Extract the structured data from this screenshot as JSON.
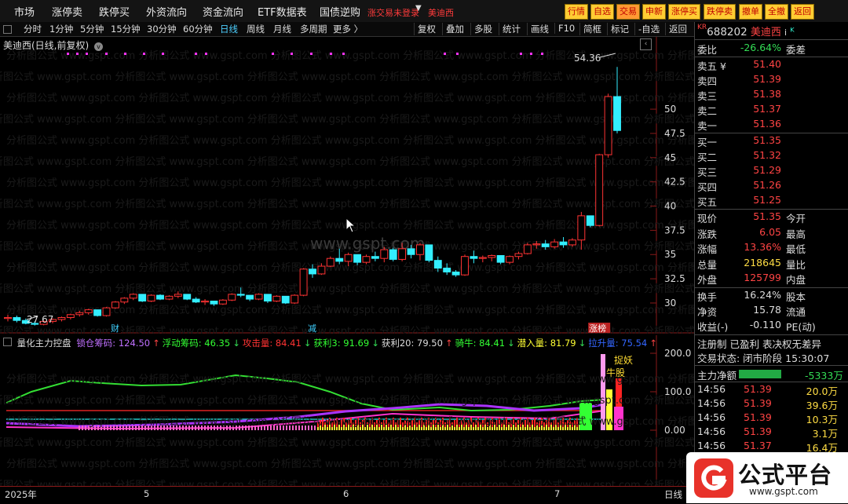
{
  "topmenu": {
    "items": [
      "市场",
      "涨停卖",
      "跌停买",
      "外资流向",
      "资金流向",
      "ETF数据表",
      "国债逆购"
    ],
    "notice": "涨交易未登录",
    "stock_name": "美迪西",
    "quick_buttons": [
      "行情",
      "自选",
      "交易",
      "申新",
      "涨停买",
      "跌停卖",
      "撤单",
      "全撤",
      "返回"
    ]
  },
  "periodbar": {
    "periods": [
      "分时",
      "1分钟",
      "5分钟",
      "15分钟",
      "30分钟",
      "60分钟",
      "日线",
      "周线",
      "月线",
      "多周期",
      "更多 〉"
    ],
    "selected": "日线",
    "tools": [
      "复权",
      "叠加",
      "多股",
      "统计",
      "画线",
      "F10",
      "简框",
      "标记",
      "-自选",
      "返回"
    ]
  },
  "chart_title": "美迪西(日线,前复权)",
  "chart_data": {
    "type": "candlestick",
    "title": "美迪西(日线,前复权)",
    "y_ticks": [
      50.0,
      47.5,
      45.0,
      42.5,
      40.0,
      37.5,
      35.0,
      32.5,
      30.0
    ],
    "ylim": [
      27.0,
      56.0
    ],
    "max_label": "54.36",
    "min_label": "27.67",
    "candles": [
      [
        28.4,
        28.8,
        28.1,
        28.5
      ],
      [
        28.5,
        28.7,
        28.0,
        28.2
      ],
      [
        28.2,
        28.4,
        27.8,
        27.9
      ],
      [
        27.9,
        28.1,
        27.67,
        27.8
      ],
      [
        27.8,
        28.2,
        27.7,
        28.1
      ],
      [
        28.1,
        28.4,
        27.9,
        28.3
      ],
      [
        28.3,
        28.6,
        28.1,
        28.5
      ],
      [
        28.5,
        28.9,
        28.3,
        28.8
      ],
      [
        28.8,
        29.2,
        28.6,
        29.0
      ],
      [
        29.0,
        29.4,
        28.8,
        29.3
      ],
      [
        29.3,
        29.0,
        28.6,
        28.7
      ],
      [
        28.7,
        29.6,
        28.6,
        29.5
      ],
      [
        29.5,
        30.2,
        29.4,
        30.1
      ],
      [
        30.1,
        30.6,
        29.9,
        30.5
      ],
      [
        30.5,
        31.0,
        30.3,
        30.9
      ],
      [
        30.9,
        30.8,
        30.1,
        30.2
      ],
      [
        30.2,
        30.9,
        30.1,
        30.8
      ],
      [
        30.8,
        30.9,
        30.3,
        30.4
      ],
      [
        30.4,
        30.8,
        30.3,
        30.7
      ],
      [
        30.7,
        31.2,
        30.5,
        30.9
      ],
      [
        30.9,
        30.8,
        30.3,
        30.4
      ],
      [
        30.4,
        30.6,
        30.0,
        30.1
      ],
      [
        30.1,
        30.4,
        29.8,
        30.2
      ],
      [
        30.2,
        30.0,
        29.7,
        29.9
      ],
      [
        29.9,
        30.4,
        29.8,
        30.3
      ],
      [
        30.3,
        31.0,
        30.2,
        30.9
      ],
      [
        30.9,
        31.6,
        30.6,
        30.8
      ],
      [
        30.8,
        30.7,
        30.2,
        30.4
      ],
      [
        30.4,
        31.0,
        30.3,
        30.9
      ],
      [
        30.9,
        30.6,
        30.0,
        30.2
      ],
      [
        30.2,
        30.8,
        30.1,
        30.7
      ],
      [
        30.7,
        30.4,
        29.9,
        30.0
      ],
      [
        30.0,
        30.9,
        29.9,
        30.8
      ],
      [
        30.8,
        33.6,
        30.7,
        33.5
      ],
      [
        33.5,
        34.0,
        32.6,
        33.0
      ],
      [
        33.0,
        34.1,
        32.9,
        33.8
      ],
      [
        33.8,
        34.8,
        33.7,
        34.6
      ],
      [
        34.6,
        35.6,
        34.0,
        34.3
      ],
      [
        34.3,
        35.2,
        33.8,
        35.0
      ],
      [
        35.0,
        34.9,
        33.9,
        34.2
      ],
      [
        34.2,
        35.0,
        34.0,
        34.8
      ],
      [
        34.8,
        35.3,
        34.3,
        34.6
      ],
      [
        34.6,
        35.8,
        34.2,
        35.5
      ],
      [
        35.5,
        35.7,
        34.3,
        34.5
      ],
      [
        34.5,
        36.2,
        34.3,
        35.6
      ],
      [
        35.6,
        36.0,
        34.6,
        35.0
      ],
      [
        35.0,
        36.2,
        34.4,
        36.0
      ],
      [
        36.0,
        35.8,
        34.2,
        34.4
      ],
      [
        34.4,
        34.8,
        33.2,
        33.6
      ],
      [
        33.6,
        34.1,
        32.9,
        33.2
      ],
      [
        33.2,
        33.4,
        32.7,
        32.9
      ],
      [
        32.9,
        35.0,
        32.8,
        34.8
      ],
      [
        34.8,
        35.4,
        34.1,
        34.6
      ],
      [
        34.6,
        34.9,
        34.2,
        34.7
      ],
      [
        34.7,
        35.0,
        34.3,
        34.9
      ],
      [
        34.9,
        34.7,
        34.0,
        34.2
      ],
      [
        34.2,
        34.9,
        34.0,
        34.8
      ],
      [
        34.8,
        35.3,
        34.5,
        35.1
      ],
      [
        35.1,
        36.2,
        35.0,
        36.0
      ],
      [
        36.0,
        36.4,
        35.6,
        36.1
      ],
      [
        36.1,
        36.5,
        35.5,
        35.8
      ],
      [
        35.8,
        36.6,
        35.6,
        36.3
      ],
      [
        36.3,
        36.8,
        35.7,
        36.0
      ],
      [
        36.0,
        36.7,
        35.8,
        36.5
      ],
      [
        36.5,
        39.4,
        35.5,
        39.0
      ],
      [
        39.0,
        38.7,
        37.8,
        38.0
      ],
      [
        38.0,
        45.4,
        37.9,
        45.3
      ],
      [
        45.3,
        51.6,
        45.0,
        51.3
      ],
      [
        51.3,
        54.36,
        47.5,
        47.8
      ]
    ],
    "dot_row_count": 16,
    "event_markers": [
      {
        "label": "财",
        "index": 12
      },
      {
        "label": "减",
        "index": 34
      },
      {
        "label": "涨榜",
        "index": 66
      }
    ]
  },
  "indicator": {
    "name": "量化主力控盘",
    "fields": [
      {
        "label": "锁仓筹码: 124.50",
        "arrow": "↑",
        "color": "#c070ff"
      },
      {
        "label": "浮动筹码: 46.35",
        "arrow": "↓",
        "color": "#33ff33"
      },
      {
        "label": "攻击量: 84.41",
        "arrow": "↓",
        "color": "#ff3333"
      },
      {
        "label": "获利3: 91.69",
        "arrow": "↓",
        "color": "#33ff33"
      },
      {
        "label": "获利20: 79.50",
        "arrow": "↑",
        "color": "#dddddd"
      },
      {
        "label": "骑牛: 84.41",
        "arrow": "↓",
        "color": "#33ff33"
      },
      {
        "label": "潜入量: 81.79",
        "arrow": "↓",
        "color": "#ffff33"
      },
      {
        "label": "拉升量: 75.54",
        "arrow": "↑",
        "color": "#3366ff"
      }
    ],
    "y_ticks": [
      "200.0",
      "100.0",
      "0.00"
    ],
    "annotations": [
      "捉妖",
      "牛股"
    ]
  },
  "xaxis": {
    "labels": [
      "2025年",
      "5",
      "6",
      "7",
      "日线"
    ]
  },
  "watermark_url": "www.gspt.com",
  "quote": {
    "code": "688202",
    "name": "美迪西",
    "tag": "KR",
    "weibi_label": "委比",
    "weibi": "-26.64%",
    "weicha_label": "委差",
    "asks": [
      {
        "label": "卖五 ¥",
        "price": "51.40"
      },
      {
        "label": "卖四",
        "price": "51.39"
      },
      {
        "label": "卖三",
        "price": "51.38"
      },
      {
        "label": "卖二",
        "price": "51.37"
      },
      {
        "label": "卖一",
        "price": "51.36"
      }
    ],
    "bids": [
      {
        "label": "买一",
        "price": "51.35"
      },
      {
        "label": "买二",
        "price": "51.32"
      },
      {
        "label": "买三",
        "price": "51.29"
      },
      {
        "label": "买四",
        "price": "51.26"
      },
      {
        "label": "买五",
        "price": "51.25"
      }
    ],
    "stats": [
      {
        "l": "现价",
        "v": "51.35",
        "r": "今开",
        "c": "#ff4444"
      },
      {
        "l": "涨跌",
        "v": "6.05",
        "r": "最高",
        "c": "#ff4444"
      },
      {
        "l": "涨幅",
        "v": "13.36%",
        "r": "最低",
        "c": "#ff4444"
      },
      {
        "l": "总量",
        "v": "218645",
        "r": "量比",
        "c": "#ffdd44"
      },
      {
        "l": "外盘",
        "v": "125799",
        "r": "内盘",
        "c": "#ff4444"
      }
    ],
    "stats2": [
      {
        "l": "换手",
        "v": "16.24%",
        "r": "股本",
        "c": "#ddd"
      },
      {
        "l": "净资",
        "v": "15.78",
        "r": "流通",
        "c": "#ddd"
      },
      {
        "l": "收益(-)",
        "v": "-0.110",
        "r": "PE(动)",
        "c": "#ddd"
      }
    ],
    "status1": "注册制 已盈利 表决权无差异",
    "status2": "交易状态: 闭市阶段 15:30:07",
    "net_label": "主力净额",
    "net_value": "-5333万",
    "ticks": [
      {
        "t": "14:56",
        "p": "51.39",
        "q": "20.0万"
      },
      {
        "t": "14:56",
        "p": "51.39",
        "q": "39.6万"
      },
      {
        "t": "14:56",
        "p": "51.39",
        "q": "10.3万"
      },
      {
        "t": "14:56",
        "p": "51.39",
        "q": "3.1万"
      },
      {
        "t": "14:56",
        "p": "51.37",
        "q": "16.4万"
      }
    ]
  },
  "logo": {
    "text": "公式平台",
    "url": "www.gspt.com"
  }
}
